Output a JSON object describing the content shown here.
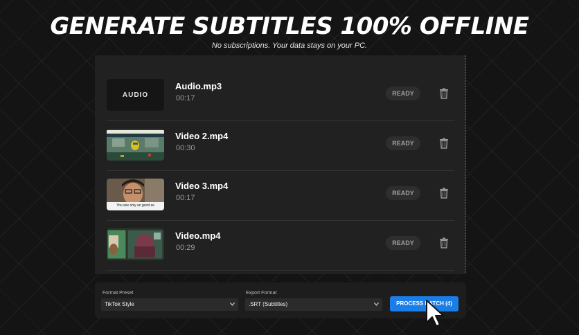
{
  "headline": "GENERATE SUBTITLES 100% OFFLINE",
  "subheadline": "No subscriptions. Your data stays on your PC.",
  "files": [
    {
      "name": "Audio.mp3",
      "duration": "00:17",
      "status": "READY",
      "thumb_label": "AUDIO",
      "thumb_type": "audio"
    },
    {
      "name": "Video 2.mp4",
      "duration": "00:30",
      "status": "READY",
      "thumb_type": "video-game"
    },
    {
      "name": "Video 3.mp4",
      "duration": "00:17",
      "status": "READY",
      "thumb_type": "video-person",
      "thumb_caption": "You see only an good as"
    },
    {
      "name": "Video.mp4",
      "duration": "00:29",
      "status": "READY",
      "thumb_type": "video-split"
    }
  ],
  "controls": {
    "format_preset_label": "Format Preset",
    "format_preset_value": "TikTok Style",
    "export_format_label": "Export Format",
    "export_format_value": ".SRT (Subtitles)",
    "process_button": "PROCESS BATCH (4)"
  },
  "icons": {
    "delete": "trash-icon",
    "dropdown": "chevron-down-icon",
    "pointer": "mouse-pointer-icon"
  },
  "colors": {
    "accent": "#1b7de6",
    "panel": "#212121",
    "background": "#141414",
    "status_pill": "#2e2e2e"
  }
}
